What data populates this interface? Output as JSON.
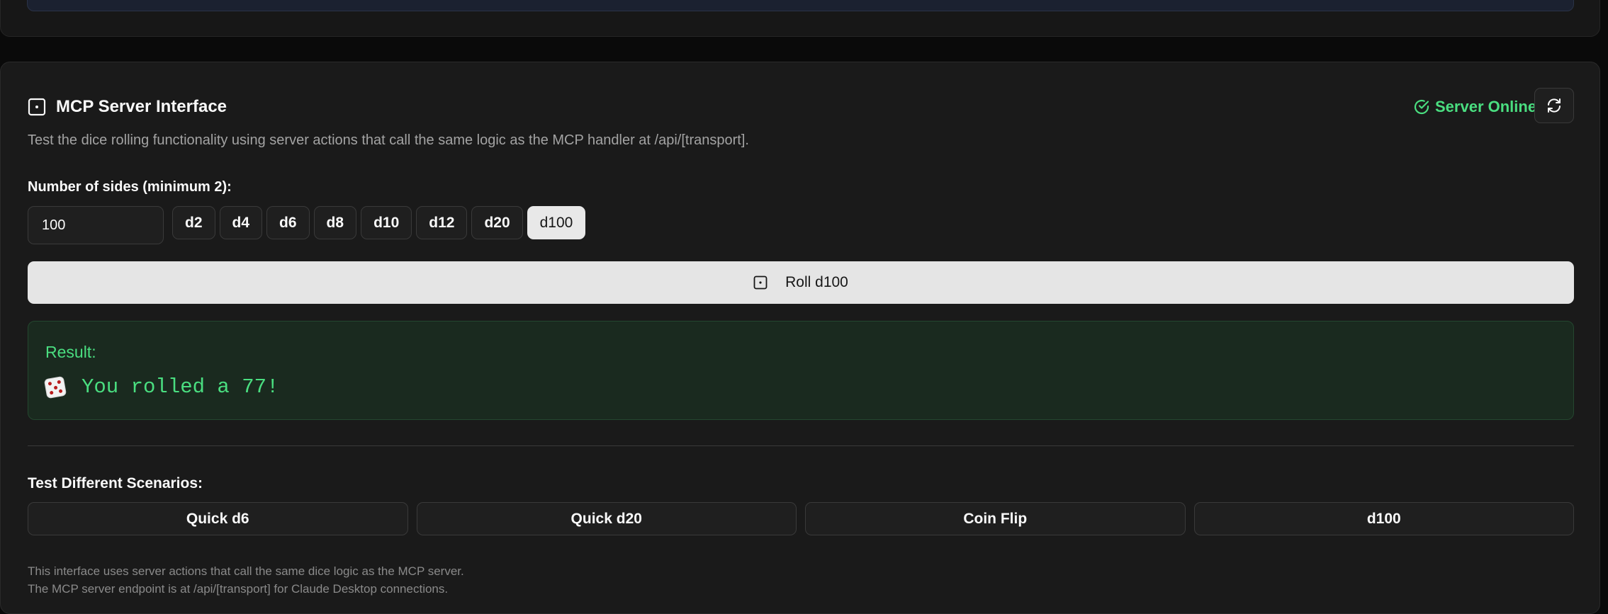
{
  "panel": {
    "title": "MCP Server Interface",
    "title_icon": "dice-square-icon",
    "status_text": "Server Online",
    "status_icon": "check-circle-icon",
    "status_color": "#4ade80",
    "refresh_icon": "refresh-icon",
    "description": "Test the dice rolling functionality using server actions that call the same logic as the MCP handler at /api/[transport]."
  },
  "sides": {
    "label": "Number of sides (minimum 2):",
    "value": "100",
    "presets": [
      "d2",
      "d4",
      "d6",
      "d8",
      "d10",
      "d12",
      "d20",
      "d100"
    ],
    "active_preset": "d100"
  },
  "roll_button": {
    "label": "Roll d100",
    "icon": "dice-square-icon"
  },
  "result": {
    "label": "Result:",
    "icon": "game-die-icon",
    "text": "You rolled a 77!",
    "color": "#4ade80"
  },
  "scenarios": {
    "label": "Test Different Scenarios:",
    "buttons": [
      "Quick d6",
      "Quick d20",
      "Coin Flip",
      "d100"
    ]
  },
  "footnote": {
    "line1": "This interface uses server actions that call the same dice logic as the MCP server.",
    "line2": "The MCP server endpoint is at /api/[transport] for Claude Desktop connections."
  }
}
